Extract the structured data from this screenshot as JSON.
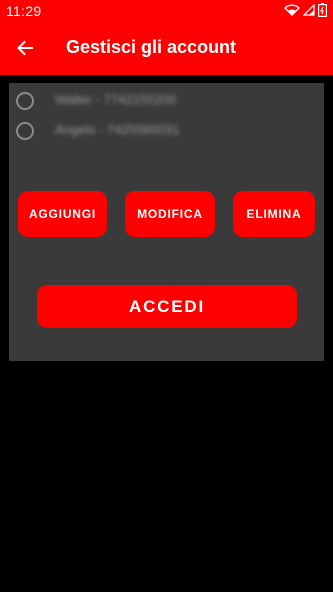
{
  "status_bar": {
    "time": "11:29",
    "icons": [
      "wifi-icon",
      "signal-icon",
      "battery-icon"
    ]
  },
  "app_bar": {
    "title": "Gestisci gli account",
    "back_icon": "arrow-left-icon"
  },
  "accounts": [
    {
      "label": "Walter - 7742155200",
      "selected": false
    },
    {
      "label": "Angelo - 7425580031",
      "selected": false
    }
  ],
  "actions": {
    "add_label": "AGGIUNGI",
    "edit_label": "MODIFICA",
    "delete_label": "ELIMINA",
    "login_label": "ACCEDI"
  },
  "colors": {
    "accent": "#ff0000",
    "panel": "#3a3a3a",
    "background": "#000000",
    "text_on_accent": "#ffffff"
  }
}
